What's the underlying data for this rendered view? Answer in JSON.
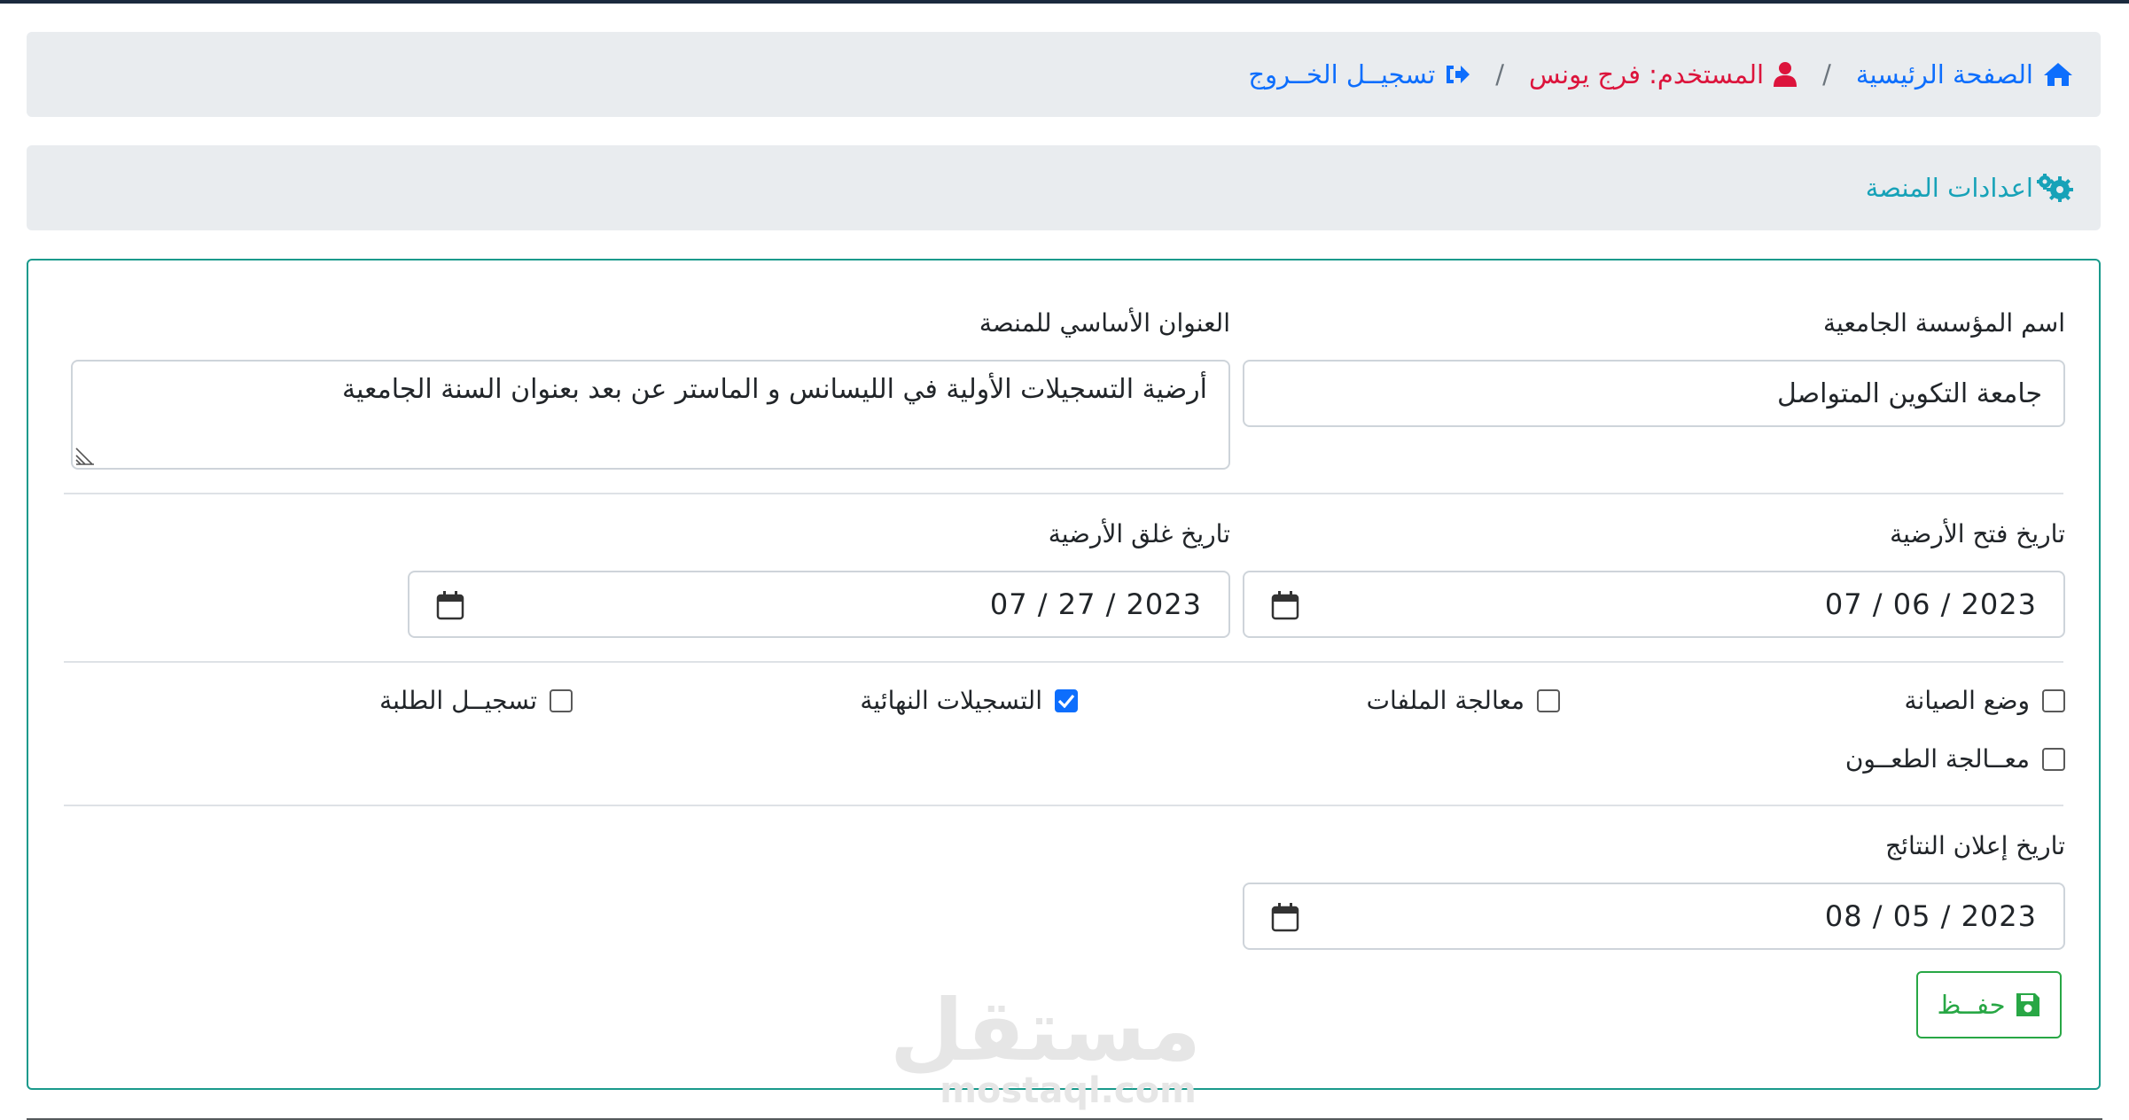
{
  "breadcrumb": {
    "home_label": "الصفحة الرئيسية",
    "user_label": "المستخدم: فرج يونس",
    "logout_label": "تسجيــل الخــروج",
    "separator": "/"
  },
  "section": {
    "title": "اعدادات المنصة"
  },
  "form": {
    "institution_label": "اسم المؤسسة الجامعية",
    "institution_value": "جامعة التكوين المتواصل",
    "title_label": "العنوان الأساسي للمنصة",
    "title_value": "أرضية التسجيلات الأولية في الليسانس و الماستر عن بعد بعنوان السنة الجامعية",
    "open_date_label": "تاريخ فتح الأرضية",
    "open_date_value": "07 / 06 / 2023",
    "close_date_label": "تاريخ غلق الأرضية",
    "close_date_value": "07 / 27 / 2023",
    "results_date_label": "تاريخ إعلان النتائج",
    "results_date_value": "08 / 05 / 2023",
    "checkboxes": {
      "maintenance": {
        "label": "وضع الصيانة",
        "checked": false
      },
      "files": {
        "label": "معالجة الملفات",
        "checked": false
      },
      "final_reg": {
        "label": "التسجيلات النهائية",
        "checked": true
      },
      "student_reg": {
        "label": "تسجيــل الطلبة",
        "checked": false
      },
      "appeals": {
        "label": "معــالجة الطعــون",
        "checked": false
      }
    },
    "save_label": "حفــظ"
  },
  "watermark": {
    "arabic": "مستقل",
    "latin": "mostaql.com"
  },
  "colors": {
    "link": "#0d6efd",
    "user": "#dc143c",
    "section_title": "#17a2b8",
    "card_border": "#1a9a8c",
    "save": "#28a745"
  },
  "icons": {
    "home": "home-icon",
    "user": "user-icon",
    "logout": "sign-out-icon",
    "settings": "cogs-icon",
    "calendar": "calendar-icon",
    "save": "floppy-disk-icon"
  }
}
